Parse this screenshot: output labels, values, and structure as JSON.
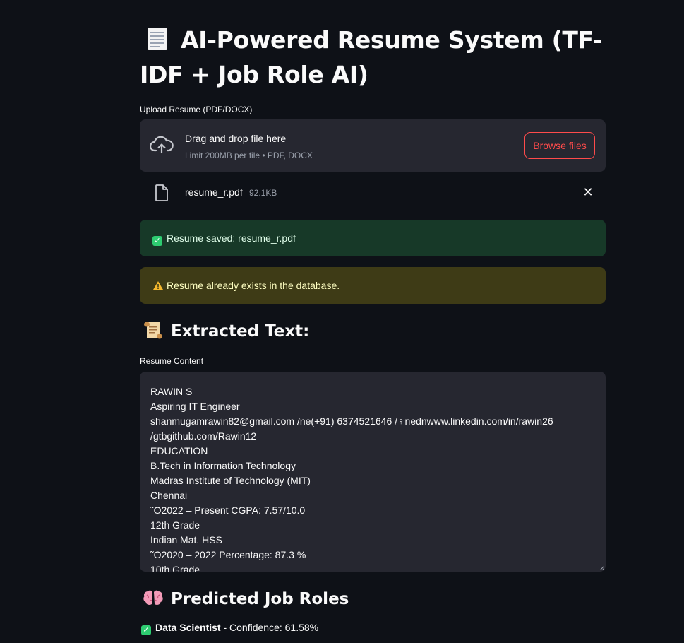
{
  "header": {
    "title": "AI-Powered Resume System (TF-IDF + Job Role AI)",
    "title_icon": "page-document-icon"
  },
  "uploader": {
    "label": "Upload Resume (PDF/DOCX)",
    "drop_title": "Drag and drop file here",
    "drop_sub": "Limit 200MB per file • PDF, DOCX",
    "browse_label": "Browse files",
    "accent": "#ff4b4b"
  },
  "uploaded_file": {
    "name": "resume_r.pdf",
    "size": "92.1KB"
  },
  "alerts": {
    "success": "Resume saved: resume_r.pdf",
    "warning": "Resume already exists in the database."
  },
  "extracted": {
    "heading": "Extracted Text:",
    "heading_icon": "scroll-icon",
    "textarea_label": "Resume Content",
    "lines": [
      "RAWIN S",
      "Aspiring IT Engineer",
      "shanmugamrawin82@gmail.com /ne(+91) 6374521646 /♀nednwww.linkedin.com/in/rawin26",
      "/gtbgithub.com/Rawin12",
      "EDUCATION",
      "B.Tech in Information Technology",
      "Madras Institute of Technology (MIT)",
      "Chennai",
      "˜O2022 – Present CGPA: 7.57/10.0",
      "12th Grade",
      "Indian Mat. HSS",
      "˜O2020 – 2022 Percentage: 87.3 %",
      "10th Grade"
    ]
  },
  "predicted": {
    "heading": "Predicted Job Roles",
    "heading_icon": "brain-icon",
    "items": [
      {
        "role": "Data Scientist",
        "suffix": " - Confidence: 61.58%"
      }
    ]
  }
}
